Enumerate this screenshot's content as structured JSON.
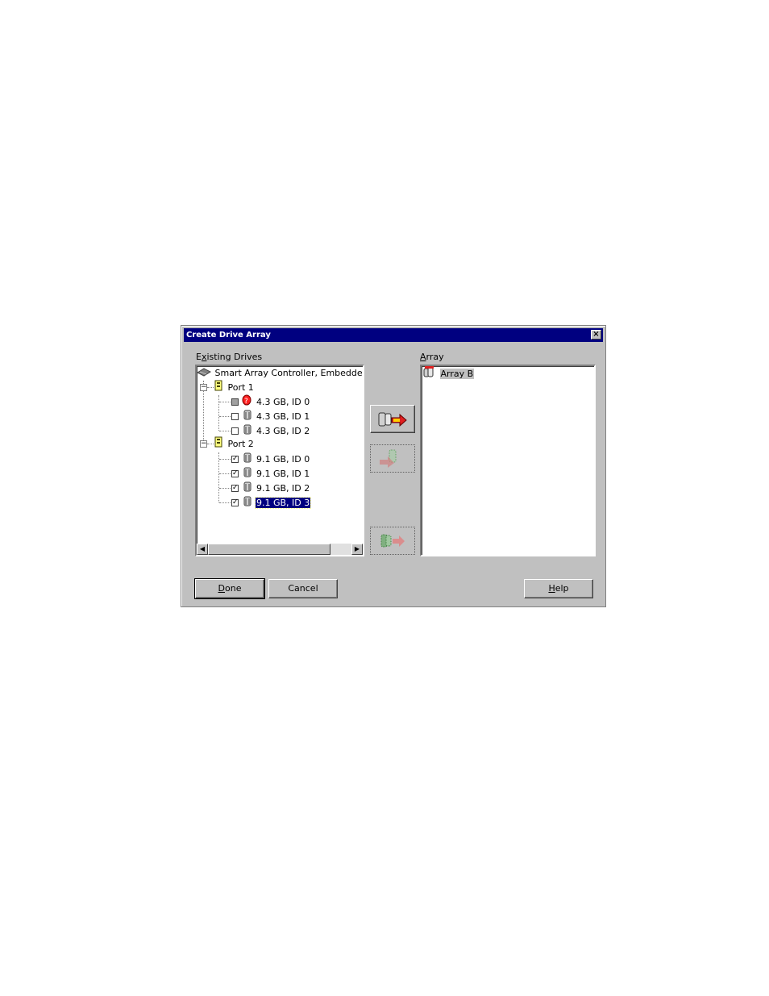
{
  "window": {
    "title": "Create Drive Array",
    "close_label": "×"
  },
  "existing_drives": {
    "label_prefix": "E",
    "label_mnemonic": "x",
    "label_rest": "isting Drives",
    "tree": {
      "controller": "Smart Array Controller, Embedded S",
      "ports": [
        {
          "label": "Port 1",
          "drives": [
            {
              "label": "4.3 GB, ID 0",
              "check": "gray",
              "failed": true
            },
            {
              "label": "4.3 GB, ID 1",
              "check": "unchecked"
            },
            {
              "label": "4.3 GB, ID 2",
              "check": "unchecked"
            }
          ]
        },
        {
          "label": "Port 2",
          "drives": [
            {
              "label": "9.1 GB, ID 0",
              "check": "checked"
            },
            {
              "label": "9.1 GB, ID 1",
              "check": "checked"
            },
            {
              "label": "9.1 GB, ID 2",
              "check": "checked"
            },
            {
              "label": "9.1 GB, ID 3",
              "check": "checked",
              "selected": true
            }
          ]
        }
      ]
    }
  },
  "array": {
    "label_mnemonic": "A",
    "label_rest": "rray",
    "items": [
      {
        "label": "Array B"
      }
    ]
  },
  "buttons": {
    "done_mnemonic": "D",
    "done_rest": "one",
    "cancel": "Cancel",
    "help_mnemonic": "H",
    "help_rest": "elp"
  },
  "icons": {
    "add_drive": "add-drive-to-array-icon",
    "remove_drive": "remove-drive-icon",
    "move_drive": "move-drive-icon"
  },
  "colors": {
    "titlebar": "#000080",
    "face": "#c0c0c0",
    "selection": "#000080"
  }
}
